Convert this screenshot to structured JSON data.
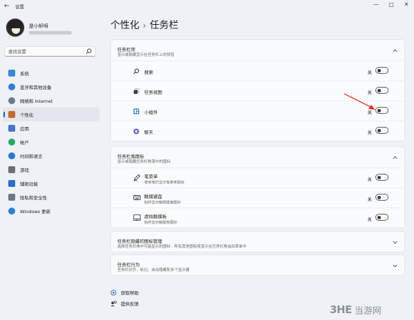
{
  "window": {
    "title": "设置",
    "back": "←",
    "minimize": "—",
    "maximize": "□",
    "close": "✕"
  },
  "profile": {
    "name": "是小轩呀"
  },
  "search": {
    "placeholder": "查找设置"
  },
  "nav": [
    {
      "label": "系统",
      "icon": "monitor-icon",
      "color": "#3b86d6"
    },
    {
      "label": "蓝牙和其他设备",
      "icon": "bluetooth-icon",
      "color": "#2e7fd1"
    },
    {
      "label": "网络和 Internet",
      "icon": "network-icon",
      "color": "#6a7a8c"
    },
    {
      "label": "个性化",
      "icon": "brush-icon",
      "color": "#c46a2f"
    },
    {
      "label": "应用",
      "icon": "apps-icon",
      "color": "#4a74c9"
    },
    {
      "label": "帐户",
      "icon": "account-icon",
      "color": "#2aa56a"
    },
    {
      "label": "时间和语言",
      "icon": "globe-clock-icon",
      "color": "#2b78d0"
    },
    {
      "label": "游戏",
      "icon": "gamepad-icon",
      "color": "#6b6f78"
    },
    {
      "label": "辅助功能",
      "icon": "accessibility-icon",
      "color": "#2a6fc2"
    },
    {
      "label": "隐私和安全性",
      "icon": "shield-icon",
      "color": "#6f7783"
    },
    {
      "label": "Windows 更新",
      "icon": "update-icon",
      "color": "#2f7fd6"
    }
  ],
  "active_nav_index": 3,
  "breadcrumb": {
    "parent": "个性化",
    "separator": "›",
    "current": "任务栏"
  },
  "sections": {
    "taskbar_items": {
      "title": "任务栏项",
      "subtitle": "显示或隐藏显示在任务栏上的按钮",
      "rows": [
        {
          "label": "搜索",
          "state": "关",
          "icon": "search-icon"
        },
        {
          "label": "任务视图",
          "state": "关",
          "icon": "task-view-icon"
        },
        {
          "label": "小组件",
          "state": "关",
          "icon": "widgets-icon"
        },
        {
          "label": "聊天",
          "state": "关",
          "icon": "chat-icon"
        }
      ]
    },
    "corner_icons": {
      "title": "任务栏角图标",
      "subtitle": "显示或隐藏任务栏角落中的图标",
      "rows": [
        {
          "label": "笔菜单",
          "sub": "使用笔时显示笔菜单图标",
          "state": "关",
          "icon": "pen-icon"
        },
        {
          "label": "触摸键盘",
          "sub": "始终显示触摸键盘图标",
          "state": "关",
          "icon": "keyboard-icon"
        },
        {
          "label": "虚拟触摸板",
          "sub": "始终显示触摸板图标",
          "state": "关",
          "icon": "touchpad-icon"
        }
      ]
    },
    "overflow": {
      "title": "任务栏隐藏的图标管理",
      "subtitle": "选择任务栏角中可能显示的图标 - 所有其他图标将显示在任务栏角溢出菜单中"
    },
    "behaviors": {
      "title": "任务栏行为",
      "subtitle": "任务栏对齐、标记、自动隐藏和多个显示器"
    }
  },
  "links": [
    {
      "label": "获取帮助",
      "icon": "help-icon"
    },
    {
      "label": "提供反馈",
      "icon": "feedback-icon"
    }
  ],
  "watermark": {
    "logo": "3HE",
    "text": "当游网"
  },
  "colors": {
    "accent": "#0a5fb4",
    "arrow": "#e5352c",
    "background": "#eef1f6",
    "card": "#f9fafb"
  }
}
